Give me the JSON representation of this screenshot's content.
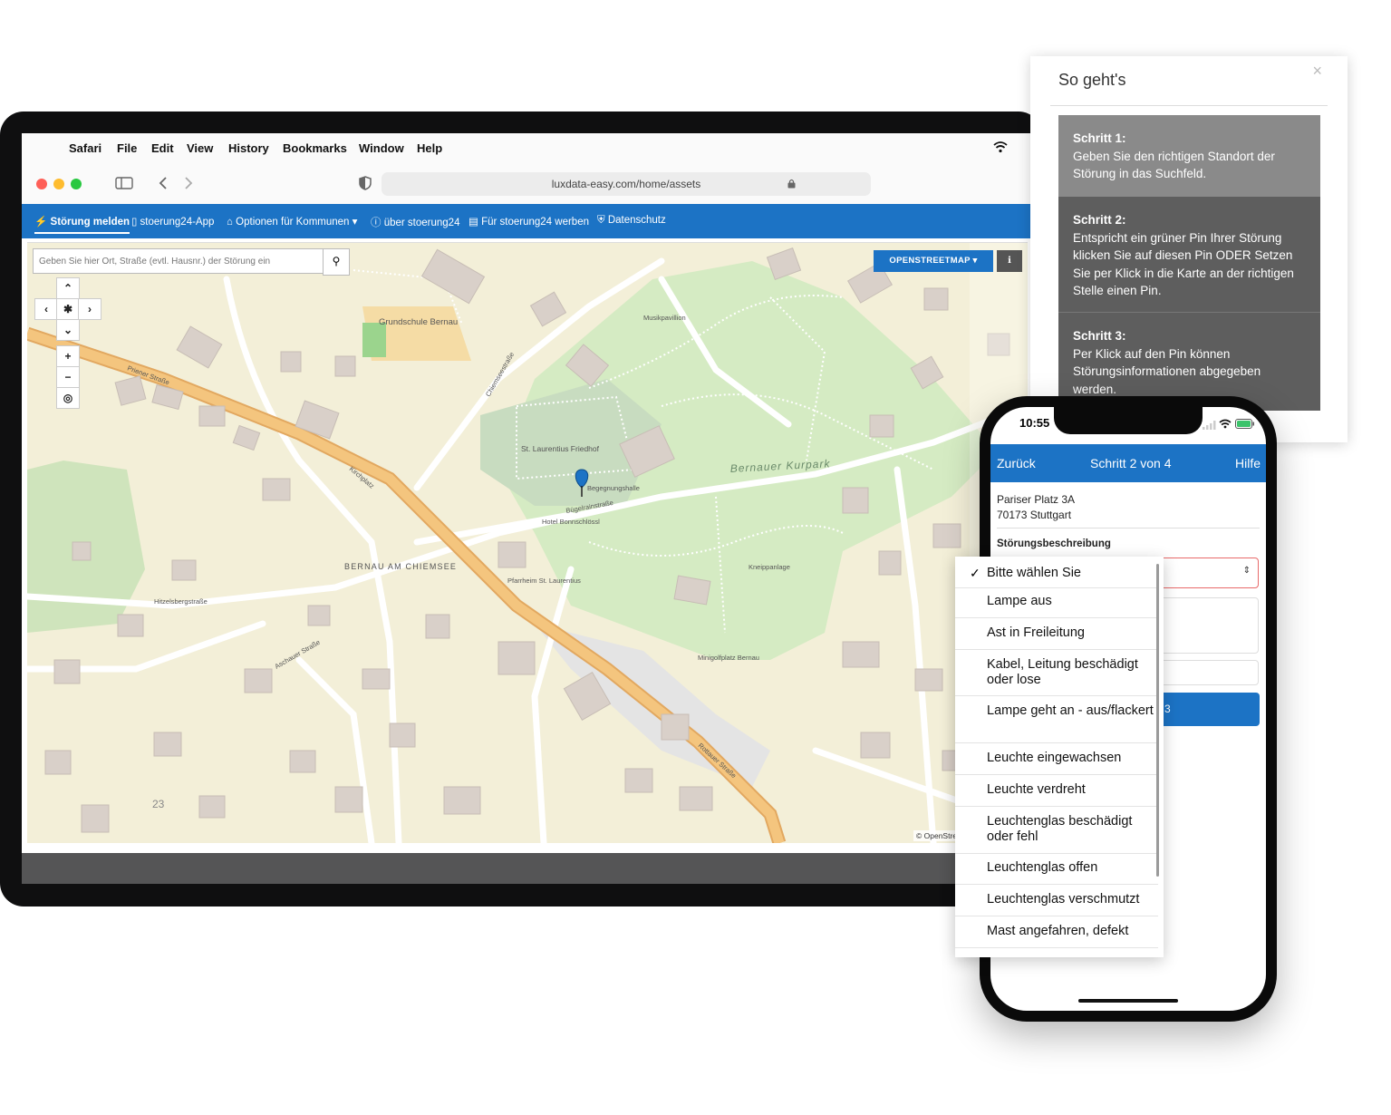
{
  "safari": {
    "menu": [
      "Safari",
      "File",
      "Edit",
      "View",
      "History",
      "Bookmarks",
      "Window",
      "Help"
    ],
    "url": "luxdata-easy.com/home/assets"
  },
  "nav": [
    {
      "label": "Störung melden",
      "icon": "bolt-icon",
      "active": true
    },
    {
      "label": "stoerung24-App",
      "icon": "mobile-icon"
    },
    {
      "label": "Optionen für Kommunen ▾",
      "icon": "building-icon"
    },
    {
      "label": "über stoerung24",
      "icon": "info-icon"
    },
    {
      "label": "Für stoerung24 werben",
      "icon": "newspaper-icon"
    },
    {
      "label": "Datenschutz",
      "icon": "shield-icon"
    }
  ],
  "map": {
    "search_placeholder": "Geben Sie hier Ort, Straße (evtl. Hausnr.) der Störung ein",
    "layer_button": "OPENSTREETMAP ▾",
    "attribution": "© OpenStre",
    "labels": [
      {
        "text": "Grundschule Bernau"
      },
      {
        "text": "St. Laurentius Friedhof"
      },
      {
        "text": "BERNAU AM CHIEMSEE"
      },
      {
        "text": "Bernauer Kurpark"
      },
      {
        "text": "Priener Straße"
      },
      {
        "text": "Kirchplatz"
      },
      {
        "text": "Rottauer Straße"
      },
      {
        "text": "Aschauer Straße"
      },
      {
        "text": "Bügelrainstraße"
      },
      {
        "text": "Chiemseestraße"
      },
      {
        "text": "Hitzelsbergstraße"
      },
      {
        "text": "Kneippanlage"
      },
      {
        "text": "Minigolfplatz Bernau"
      },
      {
        "text": "Musikpavillion"
      },
      {
        "text": "Begegnungshalle"
      },
      {
        "text": "Hotel Bonnschlössl"
      },
      {
        "text": "Pfarrheim St. Laurentius"
      },
      {
        "text": "23"
      }
    ]
  },
  "help": {
    "title": "So geht's",
    "close": "×",
    "steps": [
      {
        "title": "Schritt 1:",
        "text": "Geben Sie den richtigen Standort der Störung in das Suchfeld.",
        "color": "#8a8a8a"
      },
      {
        "title": "Schritt 2:",
        "text": "Entspricht ein grüner Pin Ihrer Störung klicken Sie auf diesen Pin ODER Setzen Sie per Klick in die Karte an der richtigen Stelle einen Pin.",
        "color": "#5e5e5e"
      },
      {
        "title": "Schritt 3:",
        "text": "Per Klick auf den Pin können Störungsinformationen abgegeben werden.",
        "color": "#5e5e5e"
      }
    ]
  },
  "phone": {
    "time": "10:55",
    "back": "Zurück",
    "step_title": "Schritt 2 von 4",
    "help": "Hilfe",
    "address_line1": "Pariser Platz 3A",
    "address_line2": "70173 Stuttgart",
    "description_label": "Störungsbeschreibung",
    "button_fragment": "3"
  },
  "dropdown": {
    "selected": "Bitte wählen Sie",
    "options": [
      "Bitte wählen Sie",
      "Lampe aus",
      "Ast in Freileitung",
      "Kabel, Leitung beschädigt oder lose",
      "Lampe geht an - aus/flackert",
      "Leuchte eingewachsen",
      "Leuchte verdreht",
      "Leuchtenglas beschädigt oder fehl",
      "Leuchtenglas offen",
      "Leuchtenglas verschmutzt",
      "Mast angefahren, defekt"
    ]
  },
  "colors": {
    "brand_blue": "#1c73c5",
    "map_bg": "#f3efd8",
    "park_green": "#d5ebc3",
    "road_orange": "#f2c47f"
  }
}
